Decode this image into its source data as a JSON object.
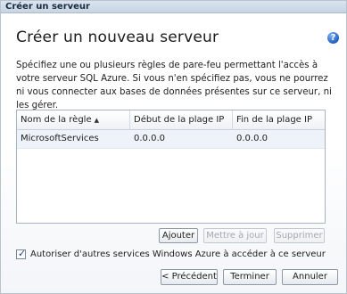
{
  "window": {
    "title": "Créer un serveur"
  },
  "page": {
    "heading": "Créer un nouveau serveur",
    "help_icon": "?",
    "description": "Spécifiez une ou plusieurs règles de pare-feu permettant l'accès à votre serveur SQL Azure. Si vous n'en spécifiez pas, vous ne pourrez ni vous connecter aux bases de données présentes sur ce serveur, ni les gérer."
  },
  "table": {
    "columns": [
      {
        "label": "Nom de la règle",
        "sort": "ascending"
      },
      {
        "label": "Début de la plage IP"
      },
      {
        "label": "Fin de la plage IP"
      }
    ],
    "sort_arrow": "▲",
    "rows": [
      {
        "name": "MicrosoftServices",
        "start_ip": "0.0.0.0",
        "end_ip": "0.0.0.0"
      }
    ]
  },
  "table_buttons": {
    "add": "Ajouter",
    "update": "Mettre à jour",
    "delete": "Supprimer"
  },
  "allow_services": {
    "checked": true,
    "check_glyph": "✓",
    "label": "Autoriser d'autres services Windows Azure à accéder à ce serveur"
  },
  "footer": {
    "previous": "< Précédent",
    "finish": "Terminer",
    "cancel": "Annuler"
  }
}
